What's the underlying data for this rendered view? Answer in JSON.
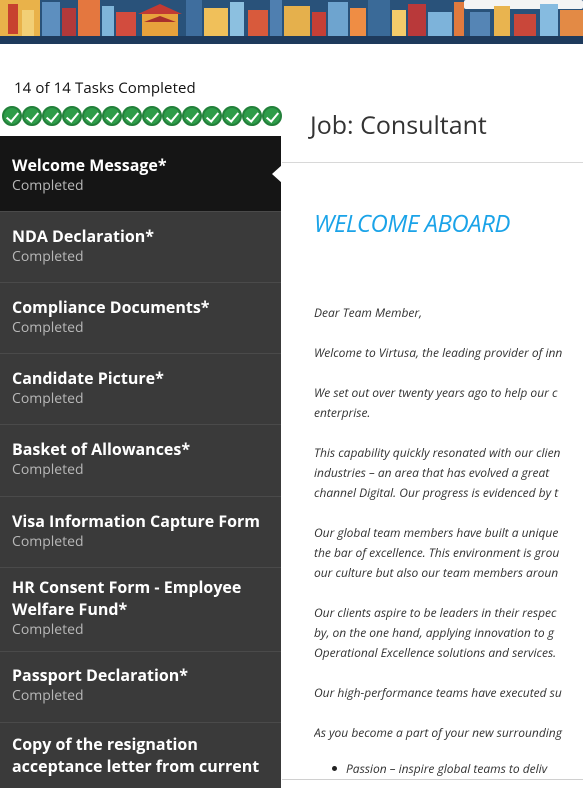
{
  "progress": {
    "title": "14 of 14 Tasks Completed",
    "completed": 14,
    "total": 14,
    "check_color": "#2e9c49"
  },
  "tasks": [
    {
      "name": "Welcome Message*",
      "status": "Completed"
    },
    {
      "name": "NDA Declaration*",
      "status": "Completed"
    },
    {
      "name": "Compliance Documents*",
      "status": "Completed"
    },
    {
      "name": "Candidate Picture*",
      "status": "Completed"
    },
    {
      "name": "Basket of Allowances*",
      "status": "Completed"
    },
    {
      "name": "Visa Information Capture Form",
      "status": "Completed"
    },
    {
      "name": "HR Consent Form - Employee Welfare Fund*",
      "status": "Completed"
    },
    {
      "name": "Passport Declaration*",
      "status": "Completed"
    },
    {
      "name": "Copy of the resignation acceptance letter from current",
      "status": ""
    }
  ],
  "job": {
    "title": "Job: Consultant"
  },
  "letter": {
    "heading": "WELCOME ABOARD",
    "heading_color": "#1aa3e8",
    "salutation": "Dear Team Member,",
    "lines": [
      "Welcome to Virtusa, the leading provider of inn",
      "We set out over twenty years ago to help our c",
      "enterprise.",
      "This capability quickly resonated with our clien",
      "industries – an area that has evolved a great",
      "channel Digital. Our progress is evidenced by t",
      "Our global team members have built a unique",
      "the bar of excellence. This environment is grou",
      "our culture but also our team members aroun",
      "Our clients aspire to be leaders in their respec",
      "by, on the one hand, applying innovation to g",
      "Operational Excellence solutions and services.",
      "Our high-performance teams have executed su",
      "As you become a part of your new surrounding"
    ],
    "bullets": [
      "Passion – inspire global teams to deliv"
    ]
  }
}
